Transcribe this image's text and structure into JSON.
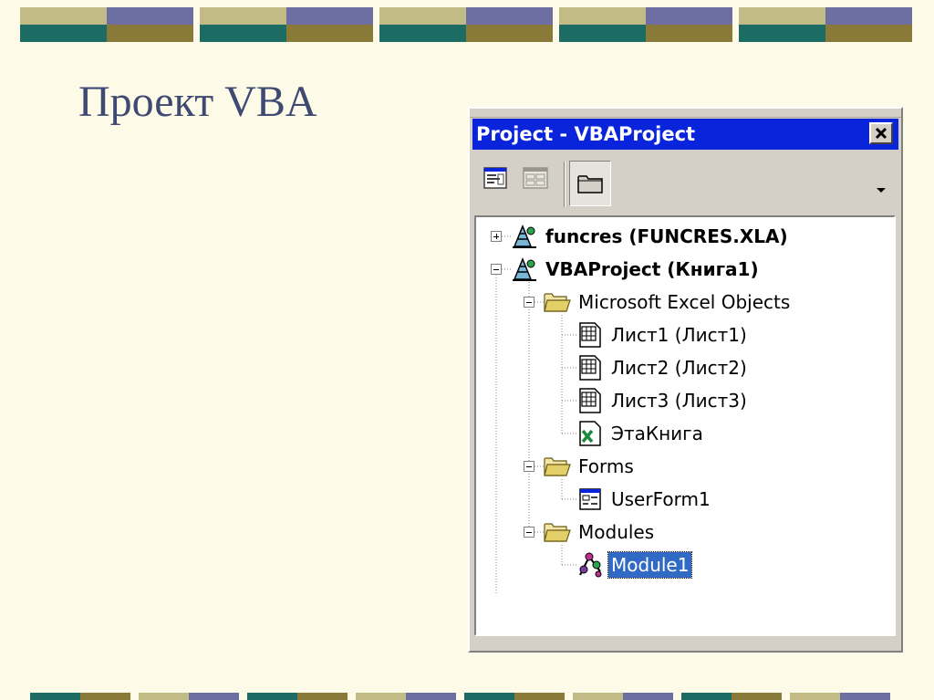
{
  "slide": {
    "title": "Проект VBA",
    "colors": {
      "background": "#fdfbe8",
      "title": "#3e4a72",
      "band_teal": "#1c6c64",
      "band_purple": "#6d6fa3",
      "band_tan": "#c2bb85",
      "band_olive": "#8a7a3a"
    }
  },
  "window": {
    "title": "Project - VBAProject",
    "close_icon": "close-x-icon",
    "toolbar": {
      "view_code_icon": "view-code-icon",
      "view_object_icon": "view-object-icon",
      "toggle_folders_icon": "folder-icon"
    },
    "tree": {
      "funcres": "funcres (FUNCRES.XLA)",
      "vbaproject": "VBAProject (Книга1)",
      "excel_objects": "Microsoft Excel Objects",
      "sheet1": "Лист1 (Лист1)",
      "sheet2": "Лист2 (Лист2)",
      "sheet3": "Лист3 (Лист3)",
      "workbook": "ЭтаКнига",
      "forms": "Forms",
      "userform1": "UserForm1",
      "modules": "Modules",
      "module1": "Module1"
    },
    "selected_item": "Module1"
  }
}
